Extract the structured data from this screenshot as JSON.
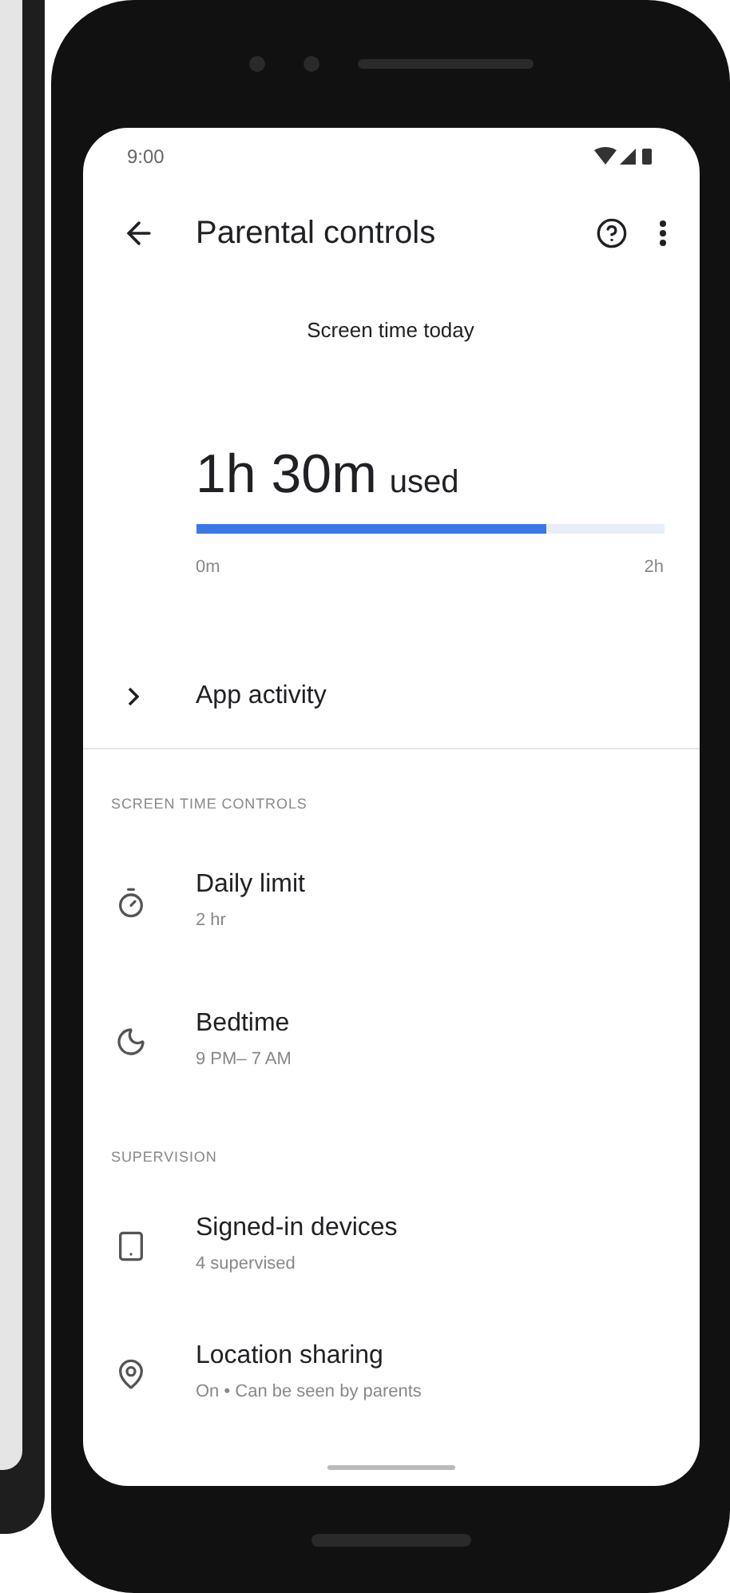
{
  "status_bar": {
    "time": "9:00"
  },
  "toolbar": {
    "title": "Parental controls"
  },
  "screen_time": {
    "heading": "Screen time today",
    "amount": "1h 30m",
    "suffix": "used",
    "level": 0.75,
    "min_label": "0m",
    "max_label": "2h"
  },
  "app_activity": {
    "label": "App activity"
  },
  "sections": [
    {
      "header": "SCREEN TIME CONTROLS",
      "items": [
        {
          "title": "Daily limit",
          "subtitle": "2 hr"
        },
        {
          "title": "Bedtime",
          "subtitle": "9 PM– 7 AM"
        }
      ]
    },
    {
      "header": "SUPERVISION",
      "items": [
        {
          "title": "Signed-in devices",
          "subtitle": "4 supervised"
        },
        {
          "title": "Location sharing",
          "subtitle": "On • Can be seen by parents"
        }
      ]
    }
  ]
}
